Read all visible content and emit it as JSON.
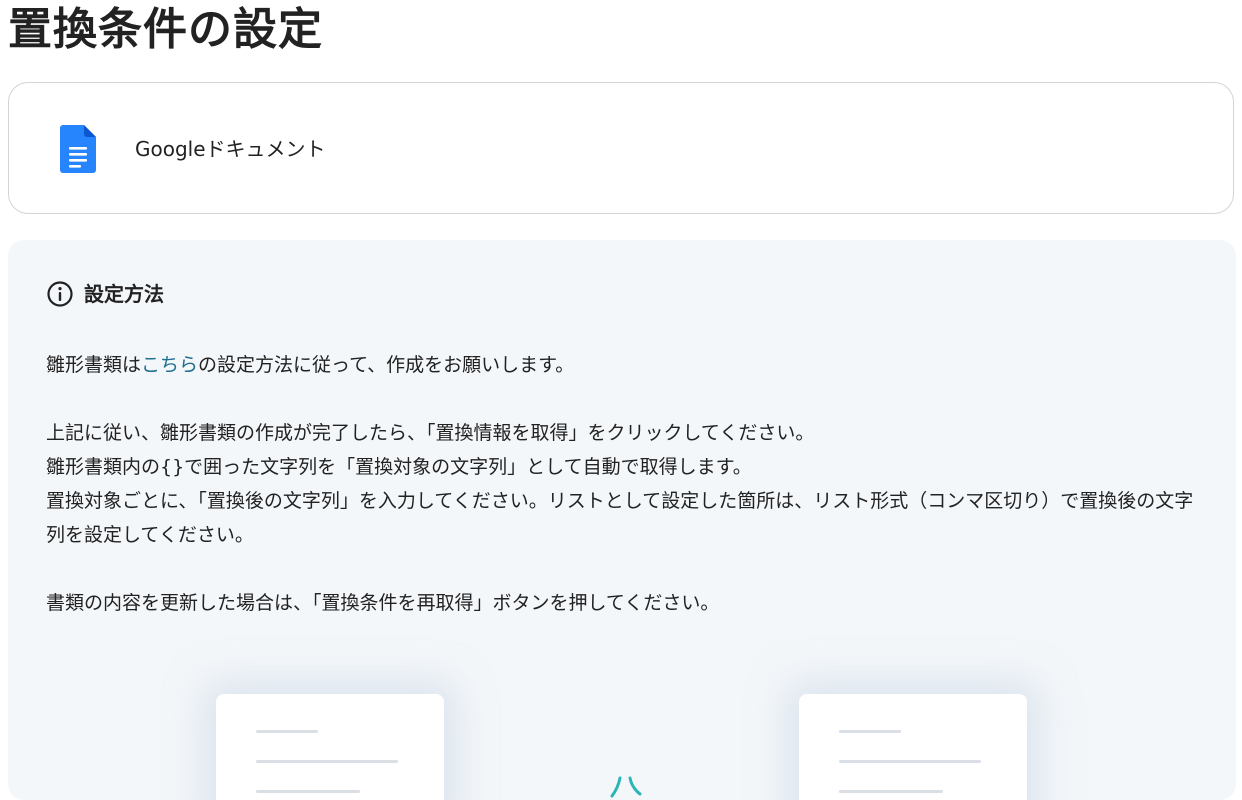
{
  "page_title": "置換条件の設定",
  "app_card": {
    "icon": "google-docs-icon",
    "name": "Googleドキュメント"
  },
  "info": {
    "icon": "info-circle-icon",
    "title": "設定方法",
    "para1_pre": "雛形書類は",
    "para1_link": "こちら",
    "para1_post": "の設定方法に従って、作成をお願いします。",
    "line2": "上記に従い、雛形書類の作成が完了したら、「置換情報を取得」をクリックしてください。",
    "line3": "雛形書類内の{}で囲った文字列を「置換対象の文字列」として自動で取得します。",
    "line4": "置換対象ごとに、「置換後の文字列」を入力してください。リストとして設定した箇所は、リスト形式（コンマ区切り）で置換後の文字列を設定してください。",
    "line5": "書類の内容を更新した場合は、「置換条件を再取得」ボタンを押してください。"
  },
  "colors": {
    "link": "#1d6f8f",
    "panel_bg": "#f4f7fa",
    "docs_blue": "#2684fc",
    "accent_teal": "#2bb5b5"
  }
}
